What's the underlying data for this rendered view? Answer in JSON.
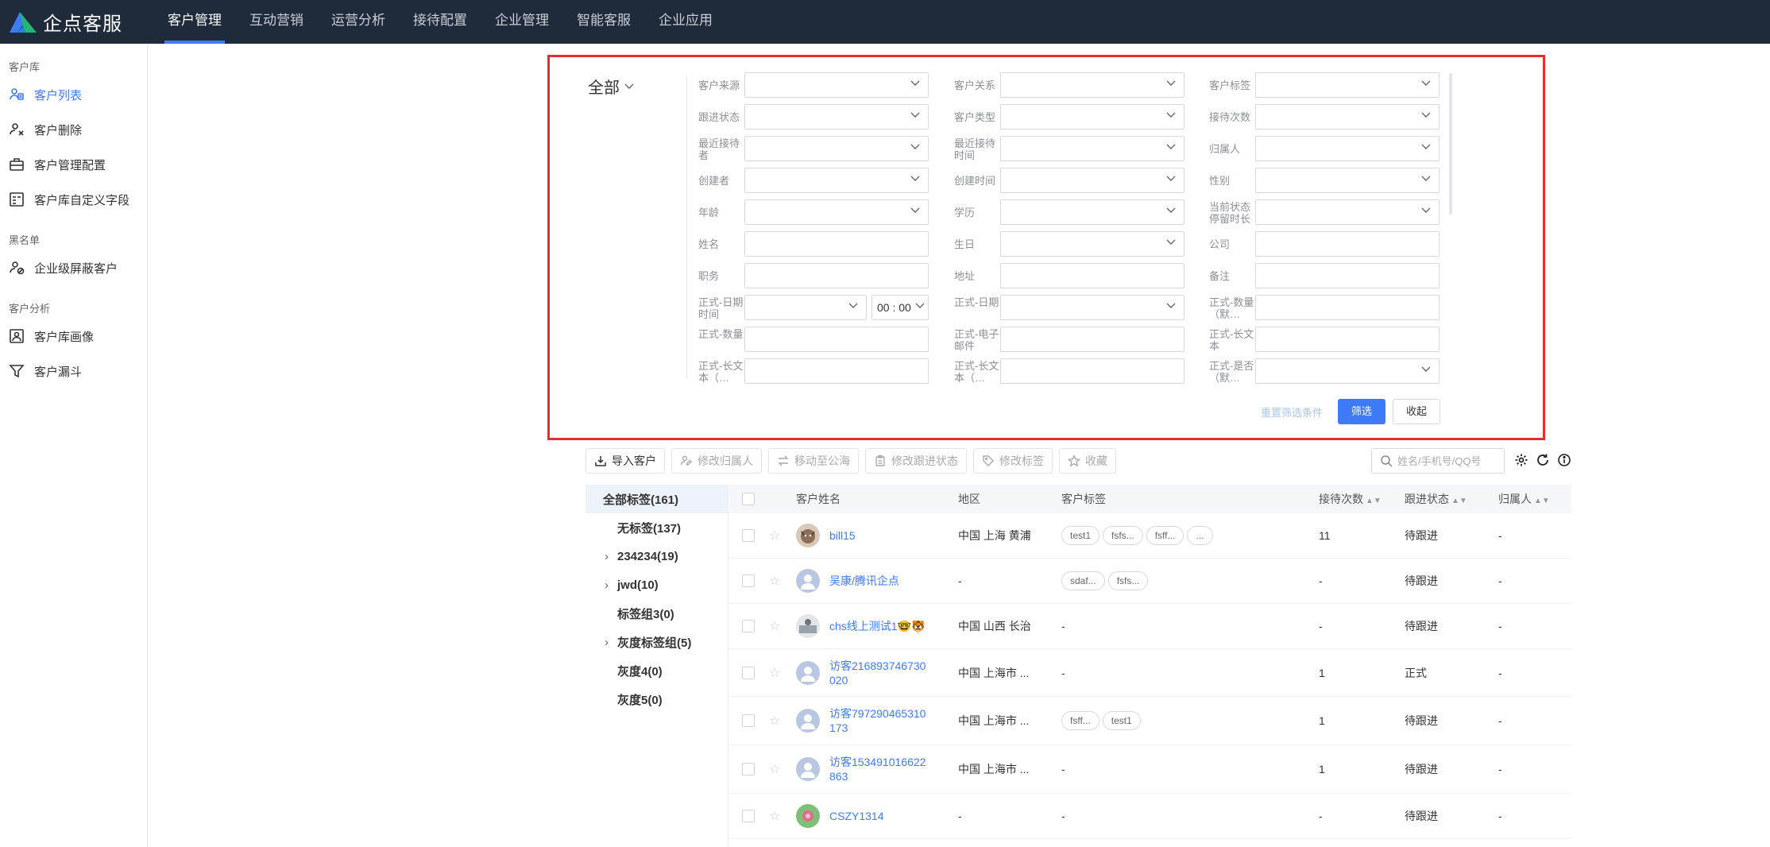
{
  "app": {
    "logo_text": "企点客服",
    "nav": [
      "客户管理",
      "互动营销",
      "运营分析",
      "接待配置",
      "企业管理",
      "智能客服",
      "企业应用"
    ]
  },
  "sidebar": {
    "group1": "客户库",
    "items1": [
      "客户列表",
      "客户删除",
      "客户管理配置",
      "客户库自定义字段"
    ],
    "group2": "黑名单",
    "items2": [
      "企业级屏蔽客户"
    ],
    "group3": "客户分析",
    "items3": [
      "客户库画像",
      "客户漏斗"
    ]
  },
  "filter": {
    "scope": "全部",
    "labels": {
      "source": "客户来源",
      "relation": "客户关系",
      "tag": "客户标签",
      "follow": "跟进状态",
      "type": "客户类型",
      "reception_count": "接待次数",
      "last_agent": "最近接待者",
      "last_time": "最近接待时间",
      "owner": "归属人",
      "creator": "创建者",
      "create_time": "创建时间",
      "gender": "性别",
      "age": "年龄",
      "education": "学历",
      "state_duration": "当前状态停留时长",
      "name": "姓名",
      "birthday": "生日",
      "company": "公司",
      "position": "职务",
      "address": "地址",
      "remark": "备注",
      "f_datetime": "正式-日期时间",
      "f_date": "正式-日期",
      "f_num_default": "正式-数量（默…",
      "f_num": "正式-数量",
      "f_email": "正式-电子邮件",
      "f_longtext": "正式-长文本",
      "f_longtext2": "正式-长文本（…",
      "f_longtext3": "正式-长文本（…",
      "f_bool": "正式-是否（默…"
    },
    "time_value": "00 : 00",
    "reset": "重置筛选条件",
    "submit": "筛选",
    "collapse": "收起"
  },
  "toolbar": {
    "import": "导入客户",
    "change_owner": "修改归属人",
    "move_pool": "移动至公海",
    "change_follow": "修改跟进状态",
    "change_tag": "修改标签",
    "favorite": "收藏",
    "search_placeholder": "姓名/手机号/QQ号"
  },
  "tags": [
    {
      "label": "全部标签(161)"
    },
    {
      "label": "无标签(137)"
    },
    {
      "label": "234234(19)"
    },
    {
      "label": "jwd(10)"
    },
    {
      "label": "标签组3(0)"
    },
    {
      "label": "灰度标签组(5)"
    },
    {
      "label": "灰度4(0)"
    },
    {
      "label": "灰度5(0)"
    }
  ],
  "table": {
    "headers": {
      "name": "客户姓名",
      "region": "地区",
      "tags": "客户标签",
      "count": "接待次数",
      "follow": "跟进状态",
      "owner": "归属人"
    },
    "rows": [
      {
        "name": "bill15",
        "region": "中国 上海 黄浦",
        "tags": [
          "test1",
          "fsfs...",
          "fsff...",
          "..."
        ],
        "count": "11",
        "follow": "待跟进",
        "owner": "-"
      },
      {
        "name": "吴康/腾讯企点",
        "region": "-",
        "tags": [
          "sdaf...",
          "fsfs..."
        ],
        "count": "-",
        "follow": "待跟进",
        "owner": "-"
      },
      {
        "name": "chs线上测试1🤓🐯",
        "region": "中国 山西 长治",
        "tags_text": "-",
        "count": "-",
        "follow": "待跟进",
        "owner": "-"
      },
      {
        "name": "访客216893746730020",
        "name_line1": "访客216893746730",
        "name_line2": "020",
        "region": "中国 上海市 ...",
        "tags_text": "-",
        "count": "1",
        "follow": "正式",
        "owner": "-"
      },
      {
        "name": "访客797290465310173",
        "name_line1": "访客797290465310",
        "name_line2": "173",
        "region": "中国 上海市 ...",
        "tags": [
          "fsff...",
          "test1"
        ],
        "count": "1",
        "follow": "待跟进",
        "owner": "-"
      },
      {
        "name": "访客153491016622863",
        "name_line1": "访客153491016622",
        "name_line2": "863",
        "region": "中国 上海市 ...",
        "tags_text": "-",
        "count": "1",
        "follow": "待跟进",
        "owner": "-"
      },
      {
        "name": "CSZY1314",
        "region": "-",
        "tags_text": "-",
        "count": "-",
        "follow": "待跟进",
        "owner": "-"
      }
    ]
  }
}
